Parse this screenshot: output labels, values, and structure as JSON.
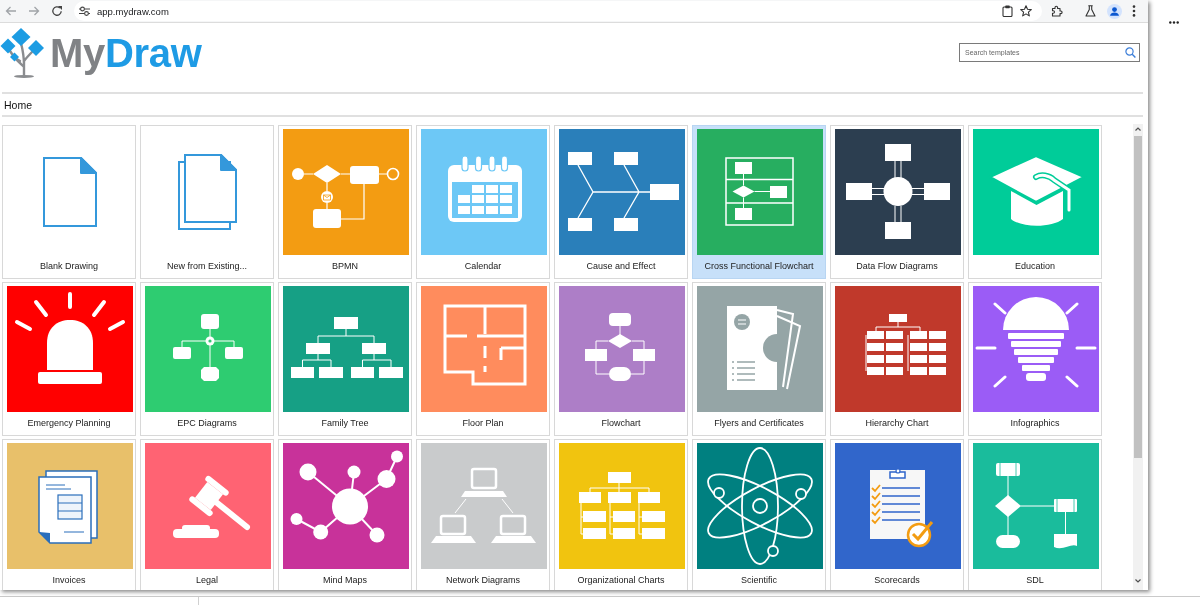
{
  "browser": {
    "url": "app.mydraw.com"
  },
  "header": {
    "logo": [
      "My",
      "Draw"
    ],
    "search": {
      "placeholder": "Search templates"
    }
  },
  "breadcrumb": {
    "label": "Home"
  },
  "templates": [
    {
      "label": "Blank Drawing",
      "kind": "blank",
      "selected": false
    },
    {
      "label": "New from Existing...",
      "kind": "copy",
      "selected": false
    },
    {
      "label": "BPMN",
      "kind": "bpmn",
      "color": "#f39c12",
      "selected": false
    },
    {
      "label": "Calendar",
      "kind": "calendar",
      "color": "#6dc8f6",
      "selected": false
    },
    {
      "label": "Cause and Effect",
      "kind": "fishbone",
      "color": "#2a7fba",
      "selected": false
    },
    {
      "label": "Cross Functional Flowchart",
      "kind": "swimlane",
      "color": "#27ae60",
      "selected": true
    },
    {
      "label": "Data Flow Diagrams",
      "kind": "dataflow",
      "color": "#2c3e50",
      "selected": false
    },
    {
      "label": "Education",
      "kind": "education",
      "color": "#00cc99",
      "selected": false
    },
    {
      "label": "Emergency Planning",
      "kind": "alarm",
      "color": "#ff0000",
      "selected": false
    },
    {
      "label": "EPC Diagrams",
      "kind": "epc",
      "color": "#2ecc71",
      "selected": false
    },
    {
      "label": "Family Tree",
      "kind": "tree",
      "color": "#16a085",
      "selected": false
    },
    {
      "label": "Floor Plan",
      "kind": "floorplan",
      "color": "#ff8c5d",
      "selected": false
    },
    {
      "label": "Flowchart",
      "kind": "flowchart",
      "color": "#ad7ec7",
      "selected": false
    },
    {
      "label": "Flyers and Certificates",
      "kind": "flyers",
      "color": "#95a5a6",
      "selected": false
    },
    {
      "label": "Hierarchy Chart",
      "kind": "hierarchy",
      "color": "#c0392b",
      "selected": false
    },
    {
      "label": "Infographics",
      "kind": "bulb",
      "color": "#9b5cf6",
      "selected": false
    },
    {
      "label": "Invoices",
      "kind": "invoice",
      "color": "#e8c06a",
      "selected": false
    },
    {
      "label": "Legal",
      "kind": "gavel",
      "color": "#ff6373",
      "selected": false
    },
    {
      "label": "Mind Maps",
      "kind": "mindmap",
      "color": "#c8329a",
      "selected": false
    },
    {
      "label": "Network Diagrams",
      "kind": "network",
      "color": "#c9cbcc",
      "selected": false
    },
    {
      "label": "Organizational Charts",
      "kind": "orgchart",
      "color": "#f1c40f",
      "selected": false
    },
    {
      "label": "Scientific",
      "kind": "atom",
      "color": "#008080",
      "selected": false
    },
    {
      "label": "Scorecards",
      "kind": "scorecard",
      "color": "#3166cb",
      "selected": false
    },
    {
      "label": "SDL",
      "kind": "sdl",
      "color": "#1abc9c",
      "selected": false
    }
  ]
}
